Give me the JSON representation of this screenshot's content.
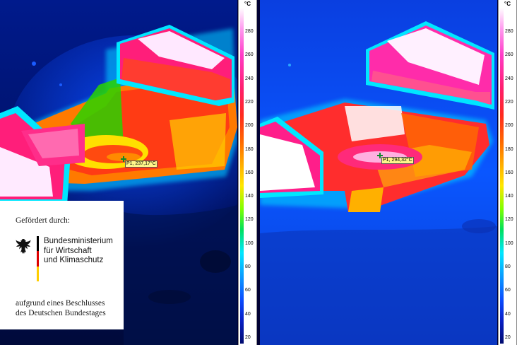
{
  "images": [
    {
      "id": "thermal-left",
      "scale_unit": "°C",
      "scale_ticks": [
        "280",
        "260",
        "240",
        "220",
        "200",
        "180",
        "160",
        "140",
        "120",
        "100",
        "80",
        "60",
        "40",
        "20"
      ],
      "marker": "P1, 237,17°C"
    },
    {
      "id": "thermal-right",
      "scale_unit": "°C",
      "scale_ticks": [
        "280",
        "260",
        "240",
        "220",
        "200",
        "180",
        "160",
        "140",
        "120",
        "100",
        "80",
        "60",
        "40",
        "20"
      ],
      "marker": "P1, 294,32°C"
    }
  ],
  "funding": {
    "heading": "Gefördert durch:",
    "ministry_lines": [
      "Bundesministerium",
      "für Wirtschaft",
      "und Klimaschutz"
    ],
    "resolution_lines": [
      "aufgrund eines Beschlusses",
      "des Deutschen Bundestages"
    ]
  },
  "colors": {
    "flag_black": "#000000",
    "flag_red": "#dd0000",
    "flag_gold": "#ffce00"
  }
}
